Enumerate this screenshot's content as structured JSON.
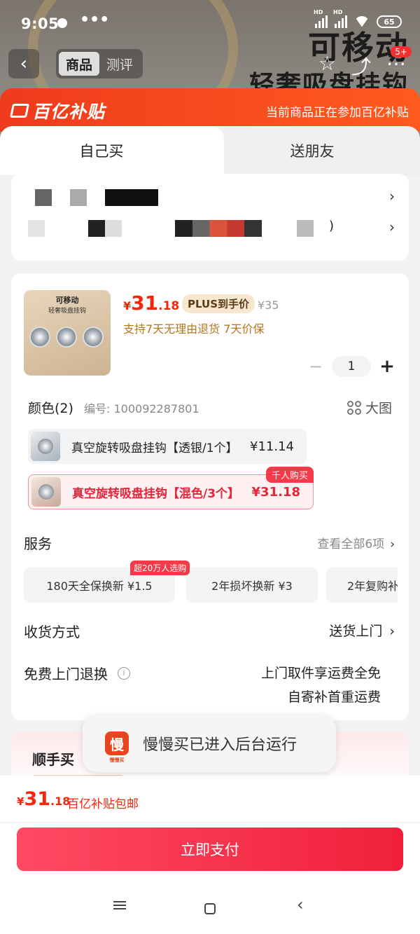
{
  "status_bar": {
    "time": "9:05",
    "dots": "•••",
    "battery": "65",
    "net_label": "HD"
  },
  "bg_page": {
    "title": "可移动",
    "subtitle": "轻奢吸盘挂钩",
    "tabs": [
      "商品",
      "测评"
    ],
    "cart_badge": "5+"
  },
  "promo": {
    "logo": "百亿补贴",
    "note": "当前商品正在参加百亿补贴"
  },
  "purchase_tabs": {
    "self": "自己买",
    "gift": "送朋友"
  },
  "address": {
    "line1_tail": "",
    "line2_tail": ")"
  },
  "product": {
    "thumb_title": "可移动",
    "thumb_subtitle": "轻奢吸盘挂钩",
    "price": {
      "currency": "¥",
      "integer": "31",
      "decimal": ".18"
    },
    "plus_tag": "PLUS到手价",
    "original_price": "¥35",
    "guarantee": "支持7天无理由退货  7天价保",
    "quantity": "1"
  },
  "color": {
    "label": "颜色(2)",
    "code": "编号: 100092287801",
    "big_pic": "大图",
    "options": [
      {
        "name": "真空旋转吸盘挂钩【透银/1个】",
        "price": "¥11.14",
        "selected": false
      },
      {
        "name": "真空旋转吸盘挂钩【混色/3个】",
        "price": "¥31.18",
        "selected": true,
        "tag": "千人购买"
      }
    ]
  },
  "services": {
    "label": "服务",
    "view_all": "查看全部6项",
    "hot_tag": "超20万人选购",
    "items": [
      "180天全保换新  ¥1.5",
      "2年损坏换新  ¥3",
      "2年复购补"
    ]
  },
  "shipping": {
    "label": "收货方式",
    "value": "送货上门"
  },
  "return": {
    "label": "免费上门退换",
    "line1": "上门取件享运费全免",
    "line2": "自寄补首重运费"
  },
  "addon": {
    "title": "顺手买"
  },
  "toast": {
    "icon_char": "慢",
    "icon_sub": "慢慢买",
    "text": "慢慢买已进入后台运行"
  },
  "footer": {
    "price": {
      "currency": "¥",
      "integer": "31",
      "decimal": ".18"
    },
    "note": "百亿补贴包邮",
    "pay_button": "立即支付"
  },
  "colors": {
    "accent": "#f2270c",
    "promo": "#ef3b1d",
    "pay": "#f0203a"
  }
}
